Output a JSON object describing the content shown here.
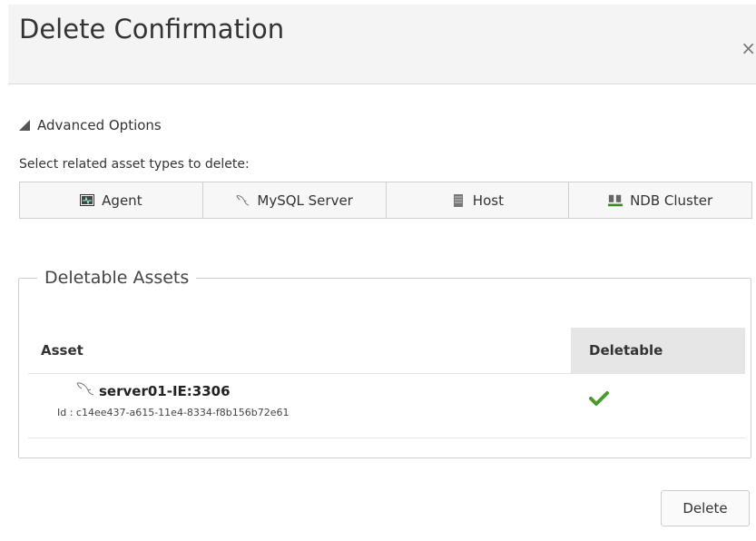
{
  "dialog": {
    "title": "Delete Confirmation",
    "close_symbol": "×"
  },
  "advanced": {
    "label": "Advanced Options",
    "select_label": "Select related asset types to delete:",
    "asset_types": [
      {
        "label": "Agent",
        "icon": "agent-icon"
      },
      {
        "label": "MySQL Server",
        "icon": "mysql-dolphin-icon"
      },
      {
        "label": "Host",
        "icon": "host-icon"
      },
      {
        "label": "NDB Cluster",
        "icon": "ndb-cluster-icon"
      }
    ]
  },
  "assets": {
    "legend": "Deletable Assets",
    "columns": [
      "Asset",
      "Deletable"
    ],
    "rows": [
      {
        "name": "server01-IE:3306",
        "id": "Id :  c14ee437-a615-11e4-8334-f8b156b72e61",
        "deletable": true,
        "status_icon": "checkmark-icon",
        "status_color": "#4a9b2f"
      }
    ]
  },
  "footer": {
    "delete_label": "Delete"
  }
}
